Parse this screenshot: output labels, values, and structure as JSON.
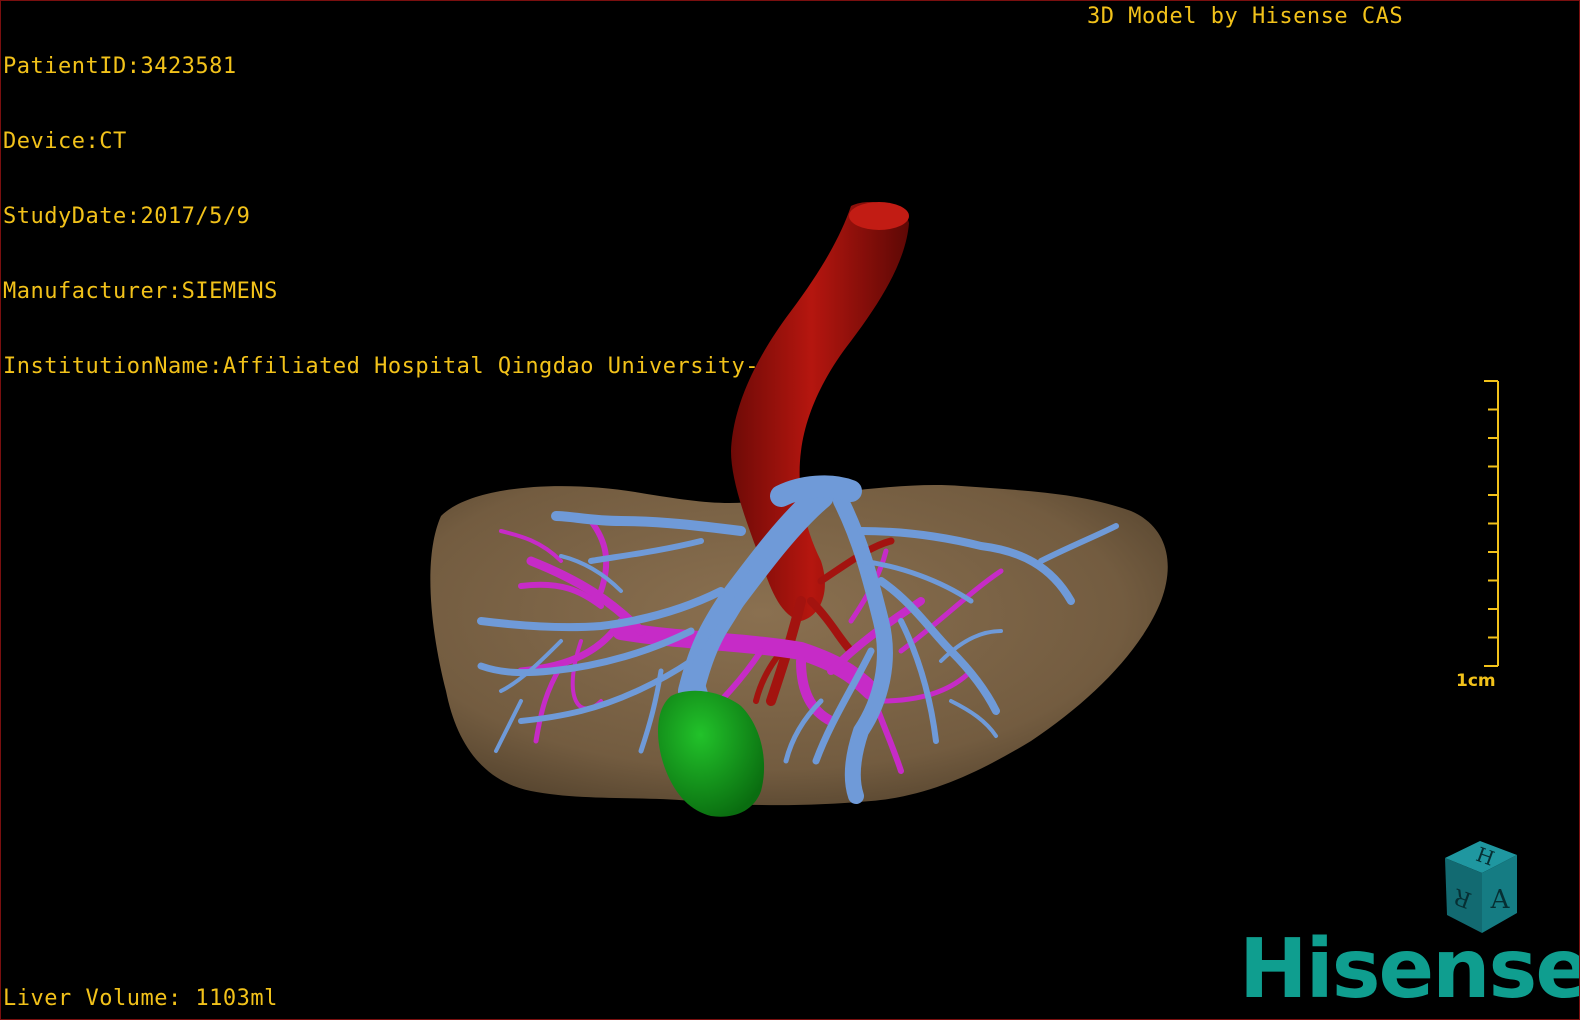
{
  "patient_info": {
    "patient_id": "PatientID:3423581",
    "device": "Device:CT",
    "study_date": "StudyDate:2017/5/9",
    "manufacturer": "Manufacturer:SIEMENS",
    "institution": "InstitutionName:Affiliated Hospital Qingdao University-C"
  },
  "model_credit": "3D Model by Hisense CAS",
  "scale_bar": {
    "label": "1cm"
  },
  "liver_volume": "Liver Volume: 1103ml",
  "orientation_cube": {
    "faces": [
      "H",
      "R",
      "A"
    ]
  },
  "brand": "Hisense",
  "colors": {
    "overlay_text": "#f2c21a",
    "liver": "#7a6245",
    "artery": "#a3130f",
    "portal_vein": "#c62bc7",
    "hepatic_vein": "#6f9ad8",
    "gallbladder": "#13a01b",
    "brand": "#0f9e8f",
    "cube": "#157c83"
  }
}
